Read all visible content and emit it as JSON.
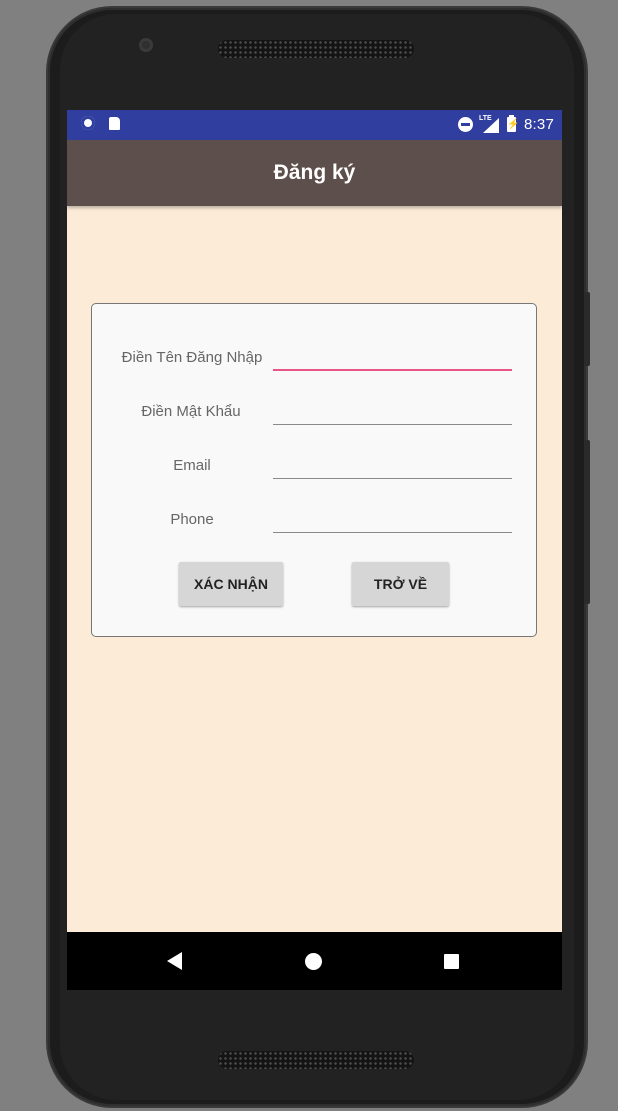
{
  "status_bar": {
    "time": "8:37",
    "lte_label": "LTE",
    "icons": [
      "record-icon",
      "sd-card-icon",
      "dnd-icon",
      "lte-signal-icon",
      "battery-charging-icon"
    ]
  },
  "app_bar": {
    "title": "Đăng ký"
  },
  "form": {
    "username_label": "Điền Tên Đăng Nhập",
    "password_label": "Điền Mật Khẩu",
    "email_label": "Email",
    "phone_label": "Phone",
    "username_value": "",
    "password_value": "",
    "email_value": "",
    "phone_value": "",
    "confirm_button": "XÁC NHẬN",
    "back_button": "TRỞ VỀ"
  },
  "colors": {
    "status_bar": "#303f9f",
    "app_bar": "#5d4f4c",
    "background": "#fbebd7",
    "focus_underline": "#e85589"
  },
  "nav_bar": {
    "icons": [
      "back-icon",
      "home-icon",
      "recents-icon"
    ]
  }
}
